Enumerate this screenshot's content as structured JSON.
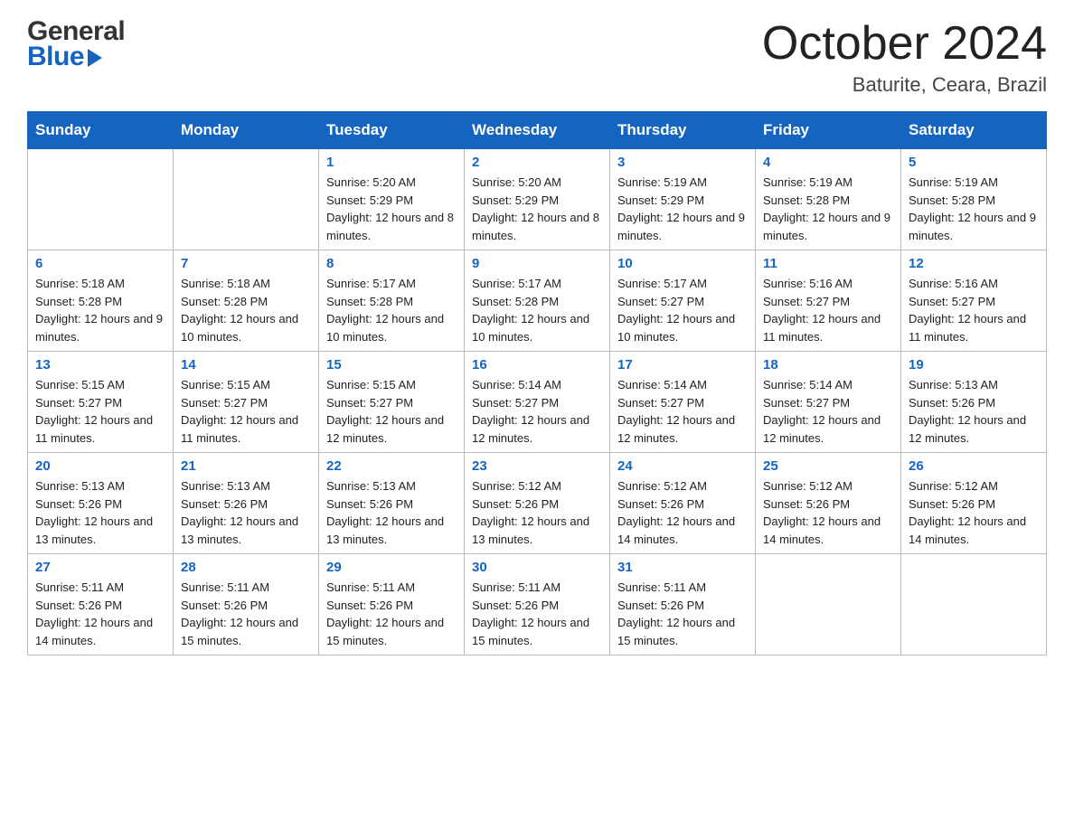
{
  "header": {
    "logo_general": "General",
    "logo_blue": "Blue",
    "month_title": "October 2024",
    "location": "Baturite, Ceara, Brazil"
  },
  "calendar": {
    "days_of_week": [
      "Sunday",
      "Monday",
      "Tuesday",
      "Wednesday",
      "Thursday",
      "Friday",
      "Saturday"
    ],
    "weeks": [
      [
        {
          "day": "",
          "info": ""
        },
        {
          "day": "",
          "info": ""
        },
        {
          "day": "1",
          "info": "Sunrise: 5:20 AM\nSunset: 5:29 PM\nDaylight: 12 hours\nand 8 minutes."
        },
        {
          "day": "2",
          "info": "Sunrise: 5:20 AM\nSunset: 5:29 PM\nDaylight: 12 hours\nand 8 minutes."
        },
        {
          "day": "3",
          "info": "Sunrise: 5:19 AM\nSunset: 5:29 PM\nDaylight: 12 hours\nand 9 minutes."
        },
        {
          "day": "4",
          "info": "Sunrise: 5:19 AM\nSunset: 5:28 PM\nDaylight: 12 hours\nand 9 minutes."
        },
        {
          "day": "5",
          "info": "Sunrise: 5:19 AM\nSunset: 5:28 PM\nDaylight: 12 hours\nand 9 minutes."
        }
      ],
      [
        {
          "day": "6",
          "info": "Sunrise: 5:18 AM\nSunset: 5:28 PM\nDaylight: 12 hours\nand 9 minutes."
        },
        {
          "day": "7",
          "info": "Sunrise: 5:18 AM\nSunset: 5:28 PM\nDaylight: 12 hours\nand 10 minutes."
        },
        {
          "day": "8",
          "info": "Sunrise: 5:17 AM\nSunset: 5:28 PM\nDaylight: 12 hours\nand 10 minutes."
        },
        {
          "day": "9",
          "info": "Sunrise: 5:17 AM\nSunset: 5:28 PM\nDaylight: 12 hours\nand 10 minutes."
        },
        {
          "day": "10",
          "info": "Sunrise: 5:17 AM\nSunset: 5:27 PM\nDaylight: 12 hours\nand 10 minutes."
        },
        {
          "day": "11",
          "info": "Sunrise: 5:16 AM\nSunset: 5:27 PM\nDaylight: 12 hours\nand 11 minutes."
        },
        {
          "day": "12",
          "info": "Sunrise: 5:16 AM\nSunset: 5:27 PM\nDaylight: 12 hours\nand 11 minutes."
        }
      ],
      [
        {
          "day": "13",
          "info": "Sunrise: 5:15 AM\nSunset: 5:27 PM\nDaylight: 12 hours\nand 11 minutes."
        },
        {
          "day": "14",
          "info": "Sunrise: 5:15 AM\nSunset: 5:27 PM\nDaylight: 12 hours\nand 11 minutes."
        },
        {
          "day": "15",
          "info": "Sunrise: 5:15 AM\nSunset: 5:27 PM\nDaylight: 12 hours\nand 12 minutes."
        },
        {
          "day": "16",
          "info": "Sunrise: 5:14 AM\nSunset: 5:27 PM\nDaylight: 12 hours\nand 12 minutes."
        },
        {
          "day": "17",
          "info": "Sunrise: 5:14 AM\nSunset: 5:27 PM\nDaylight: 12 hours\nand 12 minutes."
        },
        {
          "day": "18",
          "info": "Sunrise: 5:14 AM\nSunset: 5:27 PM\nDaylight: 12 hours\nand 12 minutes."
        },
        {
          "day": "19",
          "info": "Sunrise: 5:13 AM\nSunset: 5:26 PM\nDaylight: 12 hours\nand 12 minutes."
        }
      ],
      [
        {
          "day": "20",
          "info": "Sunrise: 5:13 AM\nSunset: 5:26 PM\nDaylight: 12 hours\nand 13 minutes."
        },
        {
          "day": "21",
          "info": "Sunrise: 5:13 AM\nSunset: 5:26 PM\nDaylight: 12 hours\nand 13 minutes."
        },
        {
          "day": "22",
          "info": "Sunrise: 5:13 AM\nSunset: 5:26 PM\nDaylight: 12 hours\nand 13 minutes."
        },
        {
          "day": "23",
          "info": "Sunrise: 5:12 AM\nSunset: 5:26 PM\nDaylight: 12 hours\nand 13 minutes."
        },
        {
          "day": "24",
          "info": "Sunrise: 5:12 AM\nSunset: 5:26 PM\nDaylight: 12 hours\nand 14 minutes."
        },
        {
          "day": "25",
          "info": "Sunrise: 5:12 AM\nSunset: 5:26 PM\nDaylight: 12 hours\nand 14 minutes."
        },
        {
          "day": "26",
          "info": "Sunrise: 5:12 AM\nSunset: 5:26 PM\nDaylight: 12 hours\nand 14 minutes."
        }
      ],
      [
        {
          "day": "27",
          "info": "Sunrise: 5:11 AM\nSunset: 5:26 PM\nDaylight: 12 hours\nand 14 minutes."
        },
        {
          "day": "28",
          "info": "Sunrise: 5:11 AM\nSunset: 5:26 PM\nDaylight: 12 hours\nand 15 minutes."
        },
        {
          "day": "29",
          "info": "Sunrise: 5:11 AM\nSunset: 5:26 PM\nDaylight: 12 hours\nand 15 minutes."
        },
        {
          "day": "30",
          "info": "Sunrise: 5:11 AM\nSunset: 5:26 PM\nDaylight: 12 hours\nand 15 minutes."
        },
        {
          "day": "31",
          "info": "Sunrise: 5:11 AM\nSunset: 5:26 PM\nDaylight: 12 hours\nand 15 minutes."
        },
        {
          "day": "",
          "info": ""
        },
        {
          "day": "",
          "info": ""
        }
      ]
    ]
  }
}
